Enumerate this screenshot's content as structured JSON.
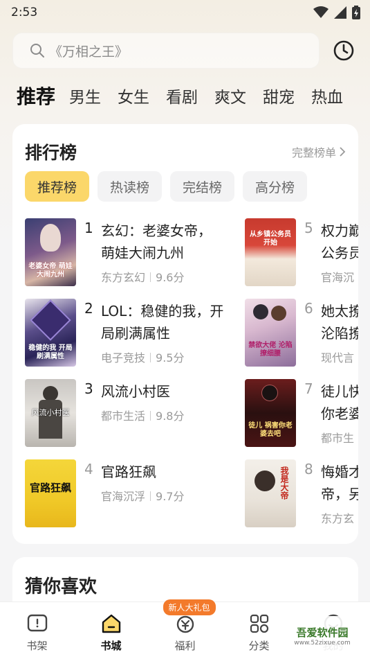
{
  "status": {
    "time": "2:53"
  },
  "search": {
    "placeholder": "《万相之王》"
  },
  "tabs": [
    {
      "label": "推荐",
      "active": true
    },
    {
      "label": "男生"
    },
    {
      "label": "女生"
    },
    {
      "label": "看剧"
    },
    {
      "label": "爽文"
    },
    {
      "label": "甜宠"
    },
    {
      "label": "热血"
    }
  ],
  "rank": {
    "title": "排行榜",
    "more": "完整榜单",
    "chips": [
      "推荐榜",
      "热读榜",
      "完结榜",
      "高分榜"
    ],
    "books": [
      {
        "num": "1",
        "title1": "玄幻：老婆女帝，",
        "title2": "萌娃大闹九州",
        "genre": "东方玄幻",
        "score": "9.6分",
        "cover_text": "老婆女帝 萌娃大闹九州"
      },
      {
        "num": "2",
        "title1": "LOL：稳健的我，开",
        "title2": "局刷满属性",
        "genre": "电子竞技",
        "score": "9.5分",
        "cover_text": "稳健的我 开局刷满属性"
      },
      {
        "num": "3",
        "title1": "风流小村医",
        "title2": "",
        "genre": "都市生活",
        "score": "9.8分",
        "cover_text": "风流小村医"
      },
      {
        "num": "4",
        "title1": "官路狂飙",
        "title2": "",
        "genre": "官海沉浮",
        "score": "9.7分",
        "cover_text": "官路狂飙"
      },
      {
        "num": "5",
        "title1": "权力巅",
        "title2": "公务员",
        "genre": "官海沉",
        "score": "",
        "cover_text": "从乡镇公务员开始"
      },
      {
        "num": "6",
        "title1": "她太撩",
        "title2": "沦陷撩",
        "genre": "现代言",
        "score": "",
        "cover_text": "禁欲大佬 沦陷撩细腰"
      },
      {
        "num": "7",
        "title1": "徒儿快",
        "title2": "你老婆",
        "genre": "都市生",
        "score": "",
        "cover_text": "徒儿 祸害你老婆去吧"
      },
      {
        "num": "8",
        "title1": "悔婚才",
        "title2": "帝，另",
        "genre": "东方玄",
        "score": "",
        "cover_text": "我是大帝"
      }
    ]
  },
  "guess": {
    "title": "猜你喜欢"
  },
  "nav": [
    {
      "label": "书架",
      "icon": "bookshelf-icon"
    },
    {
      "label": "书城",
      "icon": "bookstore-icon",
      "active": true
    },
    {
      "label": "福利",
      "icon": "gift-icon",
      "badge": "新人大礼包"
    },
    {
      "label": "分类",
      "icon": "category-icon"
    },
    {
      "label": "我的",
      "icon": "profile-icon"
    }
  ],
  "watermark": {
    "text": "吾爱软件园",
    "url": "www.52zixue.com"
  },
  "colors": {
    "accent": "#fbd76a",
    "badge": "#f37a2b",
    "muted": "#9a9a9a"
  }
}
